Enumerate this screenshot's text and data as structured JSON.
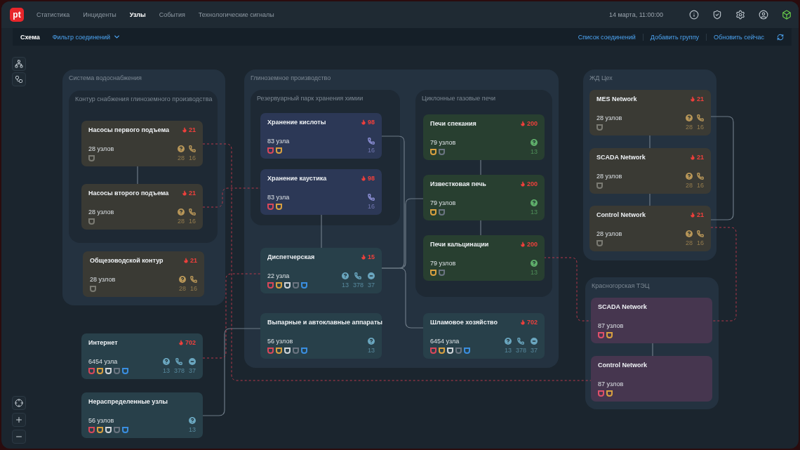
{
  "logo": "pt",
  "nav": [
    {
      "label": "Статистика",
      "selected": false
    },
    {
      "label": "Инциденты",
      "selected": false
    },
    {
      "label": "Узлы",
      "selected": true
    },
    {
      "label": "События",
      "selected": false
    },
    {
      "label": "Технологические сигналы",
      "selected": false
    }
  ],
  "datetime": "14 марта, 11:00:00",
  "toolbar": {
    "title": "Схема",
    "filter": "Фильтр соединений",
    "actions": [
      "Список соединений",
      "Добавить группу",
      "Обновить сейчас"
    ]
  },
  "groups": [
    {
      "title": "Система водоснабжения",
      "subgroups": [
        {
          "title": "Контур снабжения глиноземного производства",
          "nodes": [
            {
              "title": "Насосы первого подъема",
              "alerts": "21",
              "count": "28 узлов",
              "color": "#3a3a34",
              "shields": [
                {
                  "color": "#7a7a72"
                }
              ],
              "stats": [
                {
                  "kind": "question",
                  "color": "#b89658",
                  "value": "28"
                },
                {
                  "kind": "phone",
                  "color": "#b89658",
                  "value": "16"
                }
              ]
            },
            {
              "title": "Насосы второго подъема",
              "alerts": "21",
              "count": "28 узлов",
              "color": "#3a3a34",
              "shields": [
                {
                  "color": "#7a7a72"
                }
              ],
              "stats": [
                {
                  "kind": "question",
                  "color": "#b89658",
                  "value": "28"
                },
                {
                  "kind": "phone",
                  "color": "#b89658",
                  "value": "16"
                }
              ]
            }
          ]
        }
      ],
      "nodes": [
        {
          "title": "Общезоводской контур",
          "alerts": "21",
          "count": "28 узлов",
          "color": "#3a3a34",
          "shields": [
            {
              "color": "#7a7a72"
            }
          ],
          "stats": [
            {
              "kind": "question",
              "color": "#b89658",
              "value": "28"
            },
            {
              "kind": "phone",
              "color": "#b89658",
              "value": "16"
            }
          ]
        }
      ]
    },
    {
      "title": "Глиноземное производство",
      "subgroups": [
        {
          "title": "Резервуарный парк хранения химии",
          "nodes": [
            {
              "title": "Хранение кислоты",
              "alerts": "98",
              "count": "83 узла",
              "color": "#2c3856",
              "shields": [
                {
                  "color": "#d9475a"
                },
                {
                  "color": "#d8a040"
                }
              ],
              "stats": [
                {
                  "kind": "phone",
                  "color": "#8c8fd6",
                  "value": "16"
                }
              ]
            },
            {
              "title": "Хранение каустика",
              "alerts": "98",
              "count": "83 узла",
              "color": "#2c3856",
              "shields": [
                {
                  "color": "#d9475a"
                },
                {
                  "color": "#d8a040"
                }
              ],
              "stats": [
                {
                  "kind": "phone",
                  "color": "#8c8fd6",
                  "value": "16"
                }
              ]
            }
          ]
        },
        {
          "title": "Циклонные газовые печи",
          "nodes": [
            {
              "title": "Печи спекания",
              "alerts": "200",
              "count": "79 узлов",
              "color": "#283f30",
              "shields": [
                {
                  "color": "#d8a040"
                },
                {
                  "color": "#6a7480"
                }
              ],
              "stats": [
                {
                  "kind": "question",
                  "color": "#5fae6a",
                  "value": "13"
                }
              ]
            },
            {
              "title": "Известковая печь",
              "alerts": "200",
              "count": "79 узлов",
              "color": "#283f30",
              "shields": [
                {
                  "color": "#d8a040"
                },
                {
                  "color": "#6a7480"
                }
              ],
              "stats": [
                {
                  "kind": "question",
                  "color": "#5fae6a",
                  "value": "13"
                }
              ]
            },
            {
              "title": "Печи кальцинации",
              "alerts": "200",
              "count": "79 узлов",
              "color": "#283f30",
              "shields": [
                {
                  "color": "#d8a040"
                },
                {
                  "color": "#6a7480"
                }
              ],
              "stats": [
                {
                  "kind": "question",
                  "color": "#5fae6a",
                  "value": "13"
                }
              ]
            }
          ]
        }
      ],
      "nodes": [
        {
          "title": "Диспетчерская",
          "alerts": "15",
          "count": "22 узла",
          "color": "#28404a",
          "shields": [
            {
              "color": "#d9475a"
            },
            {
              "color": "#d8a040"
            },
            {
              "color": "#d0d4d8"
            },
            {
              "color": "#6a7480"
            },
            {
              "color": "#3a8ee0"
            }
          ],
          "stats": [
            {
              "kind": "question",
              "color": "#6aa6bf",
              "value": "13"
            },
            {
              "kind": "phone",
              "color": "#6aa6bf",
              "value": "378"
            },
            {
              "kind": "minus",
              "color": "#6aa6bf",
              "value": "37"
            }
          ]
        },
        {
          "title": "Выпарные и автоклавные аппараты",
          "count": "56 узлов",
          "color": "#28404a",
          "shields": [
            {
              "color": "#d9475a"
            },
            {
              "color": "#d8a040"
            },
            {
              "color": "#d0d4d8"
            },
            {
              "color": "#6a7480"
            },
            {
              "color": "#3a8ee0"
            }
          ],
          "stats": [
            {
              "kind": "question",
              "color": "#6aa6bf",
              "value": "13"
            }
          ]
        },
        {
          "title": "Шламовое хозяйство",
          "alerts": "702",
          "count": "6454 узла",
          "color": "#28404a",
          "shields": [
            {
              "color": "#d9475a"
            },
            {
              "color": "#d8a040"
            },
            {
              "color": "#d0d4d8"
            },
            {
              "color": "#6a7480"
            },
            {
              "color": "#3a8ee0"
            }
          ],
          "stats": [
            {
              "kind": "question",
              "color": "#6aa6bf",
              "value": "13"
            },
            {
              "kind": "phone",
              "color": "#6aa6bf",
              "value": "378"
            },
            {
              "kind": "minus",
              "color": "#6aa6bf",
              "value": "37"
            }
          ]
        }
      ]
    },
    {
      "title": "ЖД Цех",
      "nodes": [
        {
          "title": "MES Network",
          "alerts": "21",
          "count": "28 узлов",
          "color": "#3a3a34",
          "shields": [
            {
              "color": "#7a7a72"
            }
          ],
          "stats": [
            {
              "kind": "question",
              "color": "#b89658",
              "value": "28"
            },
            {
              "kind": "phone",
              "color": "#b89658",
              "value": "16"
            }
          ]
        },
        {
          "title": "SCADA Network",
          "alerts": "21",
          "count": "28 узлов",
          "color": "#3a3a34",
          "shields": [
            {
              "color": "#7a7a72"
            }
          ],
          "stats": [
            {
              "kind": "question",
              "color": "#b89658",
              "value": "28"
            },
            {
              "kind": "phone",
              "color": "#b89658",
              "value": "16"
            }
          ]
        },
        {
          "title": "Control Network",
          "alerts": "21",
          "count": "28 узлов",
          "color": "#3a3a34",
          "shields": [
            {
              "color": "#7a7a72"
            }
          ],
          "stats": [
            {
              "kind": "question",
              "color": "#b89658",
              "value": "28"
            },
            {
              "kind": "phone",
              "color": "#b89658",
              "value": "16"
            }
          ]
        }
      ]
    },
    {
      "title": "Красногорская ТЭЦ",
      "nodes": [
        {
          "title": "SCADA Network",
          "count": "87 узлов",
          "color": "#46364f",
          "shields": [
            {
              "color": "#e0506a"
            },
            {
              "color": "#d8a040"
            }
          ]
        },
        {
          "title": "Control Network",
          "count": "87 узлов",
          "color": "#46364f",
          "shields": [
            {
              "color": "#e0506a"
            },
            {
              "color": "#d8a040"
            }
          ]
        }
      ]
    }
  ],
  "nodes": [
    {
      "title": "Интернет",
      "alerts": "702",
      "count": "6454 узла",
      "color": "#28404a",
      "shields": [
        {
          "color": "#d9475a"
        },
        {
          "color": "#d8a040"
        },
        {
          "color": "#d0d4d8"
        },
        {
          "color": "#6a7480"
        },
        {
          "color": "#3a8ee0"
        }
      ],
      "stats": [
        {
          "kind": "question",
          "color": "#6aa6bf",
          "value": "13"
        },
        {
          "kind": "phone",
          "color": "#6aa6bf",
          "value": "378"
        },
        {
          "kind": "minus",
          "color": "#6aa6bf",
          "value": "37"
        }
      ]
    },
    {
      "title": "Нераспределенные узлы",
      "count": "56 узлов",
      "color": "#28404a",
      "shields": [
        {
          "color": "#d9475a"
        },
        {
          "color": "#d8a040"
        },
        {
          "color": "#d0d4d8"
        },
        {
          "color": "#6a7480"
        },
        {
          "color": "#3a8ee0"
        }
      ],
      "stats": [
        {
          "kind": "question",
          "color": "#6aa6bf",
          "value": "13"
        }
      ]
    }
  ]
}
